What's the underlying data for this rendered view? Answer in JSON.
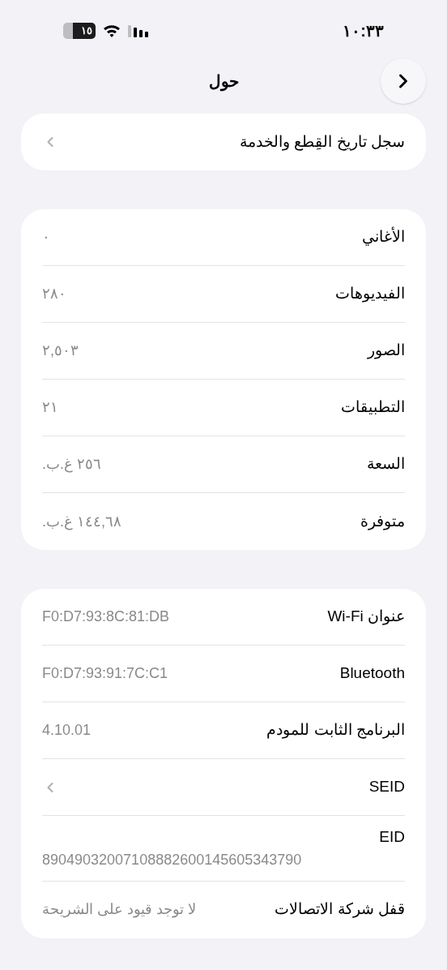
{
  "status_bar": {
    "time": "١٠:٣٣",
    "battery": "١٥"
  },
  "nav": {
    "title": "حول"
  },
  "sections": [
    {
      "rows": [
        {
          "kind": "link",
          "label": "سجل تاريخ القِطع والخدمة"
        }
      ]
    },
    {
      "rows": [
        {
          "kind": "value",
          "label": "الأغاني",
          "value": "٠"
        },
        {
          "kind": "value",
          "label": "الفيديوهات",
          "value": "٢٨٠"
        },
        {
          "kind": "value",
          "label": "الصور",
          "value": "٢,٥٠٣"
        },
        {
          "kind": "value",
          "label": "التطبيقات",
          "value": "٢١"
        },
        {
          "kind": "value",
          "label": "السعة",
          "value": "٢٥٦ غ.ب."
        },
        {
          "kind": "value",
          "label": "متوفرة",
          "value": "١٤٤,٦٨ غ.ب."
        }
      ]
    },
    {
      "rows": [
        {
          "kind": "value",
          "label": "عنوان Wi-Fi",
          "value": "F0:D7:93:8C:81:DB"
        },
        {
          "kind": "value",
          "label": "Bluetooth",
          "value": "F0:D7:93:91:7C:C1"
        },
        {
          "kind": "value",
          "label": "البرنامج الثابت للمودم",
          "value": "4.10.01"
        },
        {
          "kind": "link",
          "label": "SEID"
        },
        {
          "kind": "stacked",
          "label": "EID",
          "value": "89049032007108882600145605343790"
        },
        {
          "kind": "value",
          "label": "قفل شركة الاتصالات",
          "value": "لا توجد قيود على الشريحة"
        }
      ]
    }
  ]
}
